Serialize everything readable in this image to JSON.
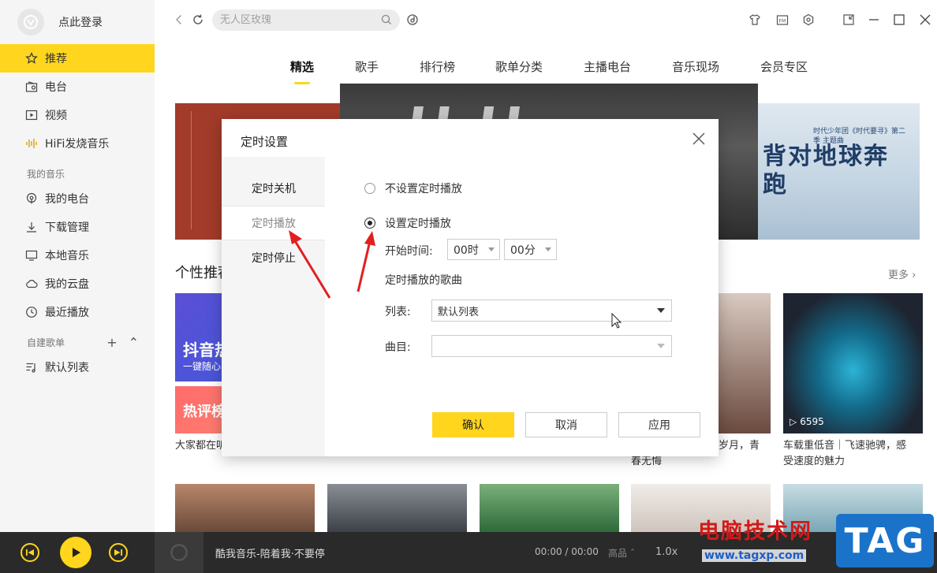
{
  "sidebar": {
    "login": "点此登录",
    "items": [
      {
        "label": "推荐",
        "icon": "star-icon",
        "active": true
      },
      {
        "label": "电台",
        "icon": "radio-icon"
      },
      {
        "label": "视频",
        "icon": "video-icon"
      },
      {
        "label": "HiFi发烧音乐",
        "icon": "waveform-icon"
      }
    ],
    "my_music_title": "我的音乐",
    "my_music": [
      {
        "label": "我的电台",
        "icon": "podcast-icon"
      },
      {
        "label": "下载管理",
        "icon": "download-icon"
      },
      {
        "label": "本地音乐",
        "icon": "monitor-icon"
      },
      {
        "label": "我的云盘",
        "icon": "cloud-icon"
      },
      {
        "label": "最近播放",
        "icon": "clock-icon"
      }
    ],
    "playlist_title": "自建歌单",
    "playlists": [
      {
        "label": "默认列表",
        "icon": "playlist-icon"
      }
    ]
  },
  "topbar": {
    "search_placeholder": "无人区玫瑰"
  },
  "tabs": [
    "精选",
    "歌手",
    "排行榜",
    "歌单分类",
    "主播电台",
    "音乐现场",
    "会员专区"
  ],
  "banner": {
    "right_title": "背对地球奔跑",
    "right_small": "时代少年团《时代要寻》第二季 主题曲"
  },
  "section": {
    "heading": "个性推荐",
    "more": "更多 ›"
  },
  "cards": {
    "c1_line1": "抖音热",
    "c1_line2": "一键随心",
    "c1b": "热评榜",
    "c1_caption": "大家都在听",
    "c4_caption": "岁月，青春无悔",
    "c4_caption_a": "岁月，青",
    "c4_caption_b": "春无悔",
    "c5_playcount": "6595",
    "c5_caption_a": "车载重低音｜飞速驰骋，感",
    "c5_caption_b": "受速度的魅力"
  },
  "player": {
    "title": "酷我音乐-陪着我·不要停",
    "time": "00:00 / 00:00",
    "quality": "高品 ˆ",
    "speed": "1.0x"
  },
  "watermark": {
    "text": "电脑技术网",
    "url": "www.tagxp.com",
    "tag": "TAG"
  },
  "dialog": {
    "title": "定时设置",
    "side": [
      "定时关机",
      "定时播放",
      "定时停止"
    ],
    "opt_off": "不设置定时播放",
    "opt_on": "设置定时播放",
    "start_label": "开始时间:",
    "hour": "00时",
    "minute": "00分",
    "songs_label": "定时播放的歌曲",
    "list_label": "列表:",
    "list_value": "默认列表",
    "track_label": "曲目:",
    "track_value": "",
    "confirm": "确认",
    "cancel": "取消",
    "apply": "应用"
  },
  "colors": {
    "accent": "#ffd51e",
    "arrow": "#e02020",
    "player_bg": "#2a2a2a"
  }
}
